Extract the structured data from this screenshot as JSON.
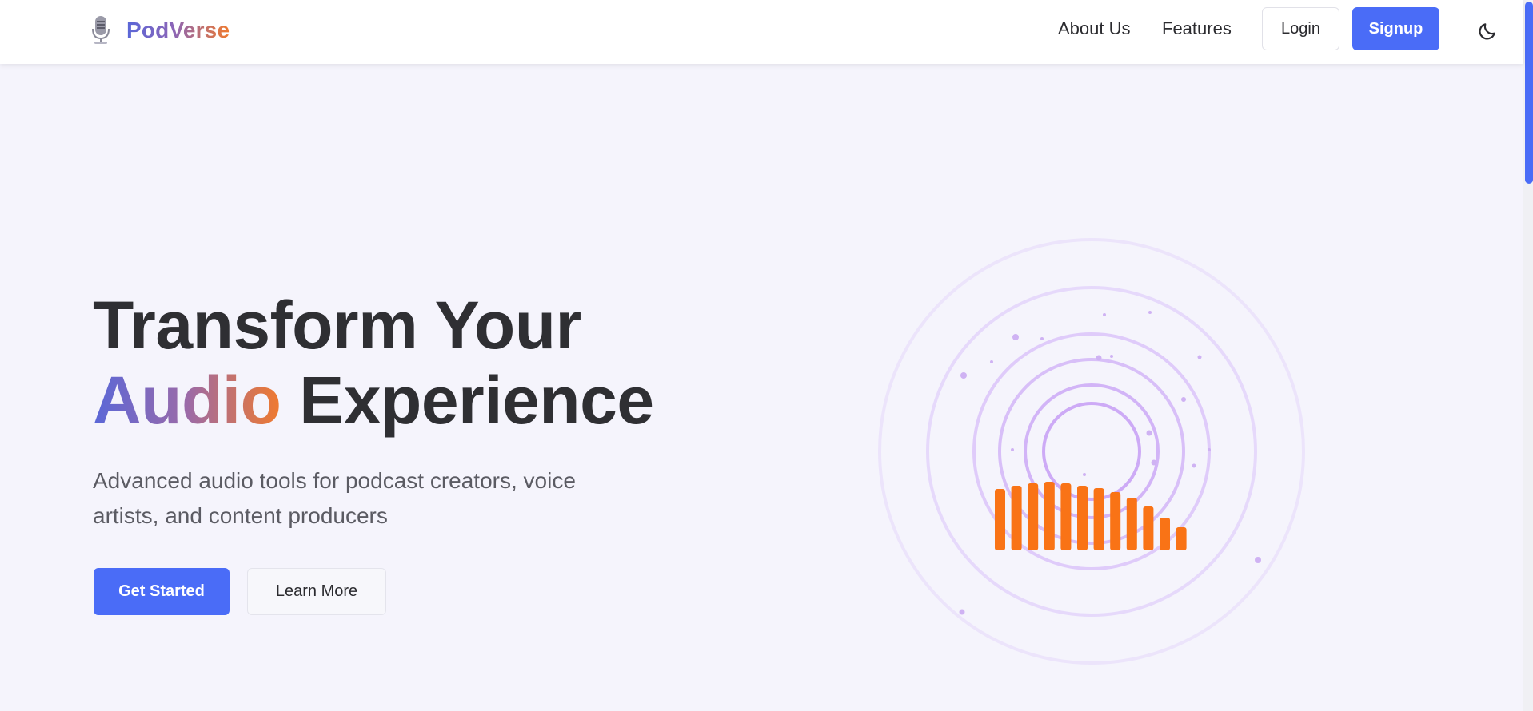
{
  "brand": {
    "name": "PodVerse",
    "icon": "microphone-icon",
    "gradient": [
      "#5a67d8",
      "#f07a2e"
    ]
  },
  "nav": {
    "about": "About Us",
    "features": "Features",
    "login": "Login",
    "signup": "Signup",
    "theme_toggle_icon": "moon-icon"
  },
  "hero": {
    "title_line1": "Transform Your",
    "title_highlight": "Audio",
    "title_line2_rest": " Experience",
    "subtitle": "Advanced audio tools for podcast creators, voice artists, and content producers",
    "primary_cta": "Get Started",
    "secondary_cta": "Learn More"
  },
  "visual": {
    "icon": "audio-waveform-icon",
    "bar_color": "#f97316",
    "ring_color": "#c9a8f5",
    "bar_levels": [
      0.77,
      0.81,
      0.84,
      0.86,
      0.84,
      0.81,
      0.78,
      0.73,
      0.66,
      0.55,
      0.41,
      0.29
    ]
  },
  "colors": {
    "accent": "#4a6cf7",
    "background": "#f5f4fc",
    "text": "#2f2f33"
  }
}
